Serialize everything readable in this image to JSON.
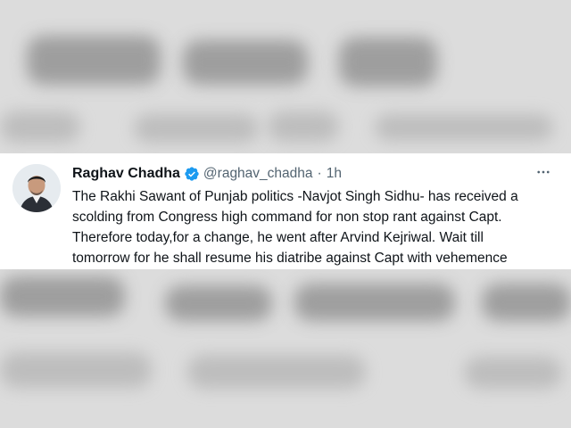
{
  "tweet": {
    "author_name": "Raghav Chadha",
    "handle": "@raghav_chadha",
    "separator": "·",
    "time": "1h",
    "text": "The Rakhi Sawant of Punjab politics -Navjot Singh Sidhu- has received a\nscolding from Congress high command for non stop rant against Capt.\nTherefore today,for a change, he went after Arvind Kejriwal. Wait till\ntomorrow for he shall resume his diatribe against Capt with vehemence",
    "verified_icon": "verified-badge-icon",
    "more_icon": "more-options-icon",
    "colors": {
      "verified": "#1d9bf0",
      "secondary_text": "#536471",
      "primary_text": "#0f1419"
    }
  }
}
